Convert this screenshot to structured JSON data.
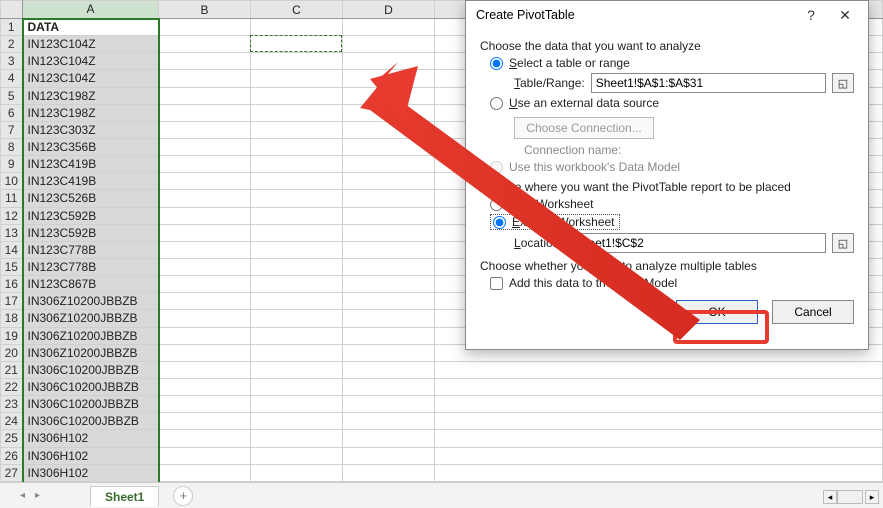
{
  "columns": [
    "A",
    "B",
    "C",
    "D"
  ],
  "header_cell": "DATA",
  "rows": [
    "IN123C104Z",
    "IN123C104Z",
    "IN123C104Z",
    "IN123C198Z",
    "IN123C198Z",
    "IN123C303Z",
    "IN123C356B",
    "IN123C419B",
    "IN123C419B",
    "IN123C526B",
    "IN123C592B",
    "IN123C592B",
    "IN123C778B",
    "IN123C778B",
    "IN123C867B",
    "IN306Z10200JBBZB",
    "IN306Z10200JBBZB",
    "IN306Z10200JBBZB",
    "IN306Z10200JBBZB",
    "IN306C10200JBBZB",
    "IN306C10200JBBZB",
    "IN306C10200JBBZB",
    "IN306C10200JBBZB",
    "IN306H102",
    "IN306H102",
    "IN306H102"
  ],
  "sheet_tab": "Sheet1",
  "dialog": {
    "title": "Create PivotTable",
    "analyze_label": "Choose the data that you want to analyze",
    "select_table_label": "Select a table or range",
    "table_range_label": "Table/Range:",
    "table_range_value": "Sheet1!$A$1:$A$31",
    "external_label": "Use an external data source",
    "choose_connection": "Choose Connection...",
    "connection_name": "Connection name:",
    "workbook_dm": "Use this workbook's Data Model",
    "placement_label": "Choose where you want the PivotTable report to be placed",
    "new_ws": "New Worksheet",
    "existing_ws": "Existing Worksheet",
    "location_label": "Location:",
    "location_value": "Sheet1!$C$2",
    "multi_label": "Choose whether you want to analyze multiple tables",
    "add_dm": "Add this data to the Data Model",
    "ok": "OK",
    "cancel": "Cancel"
  }
}
